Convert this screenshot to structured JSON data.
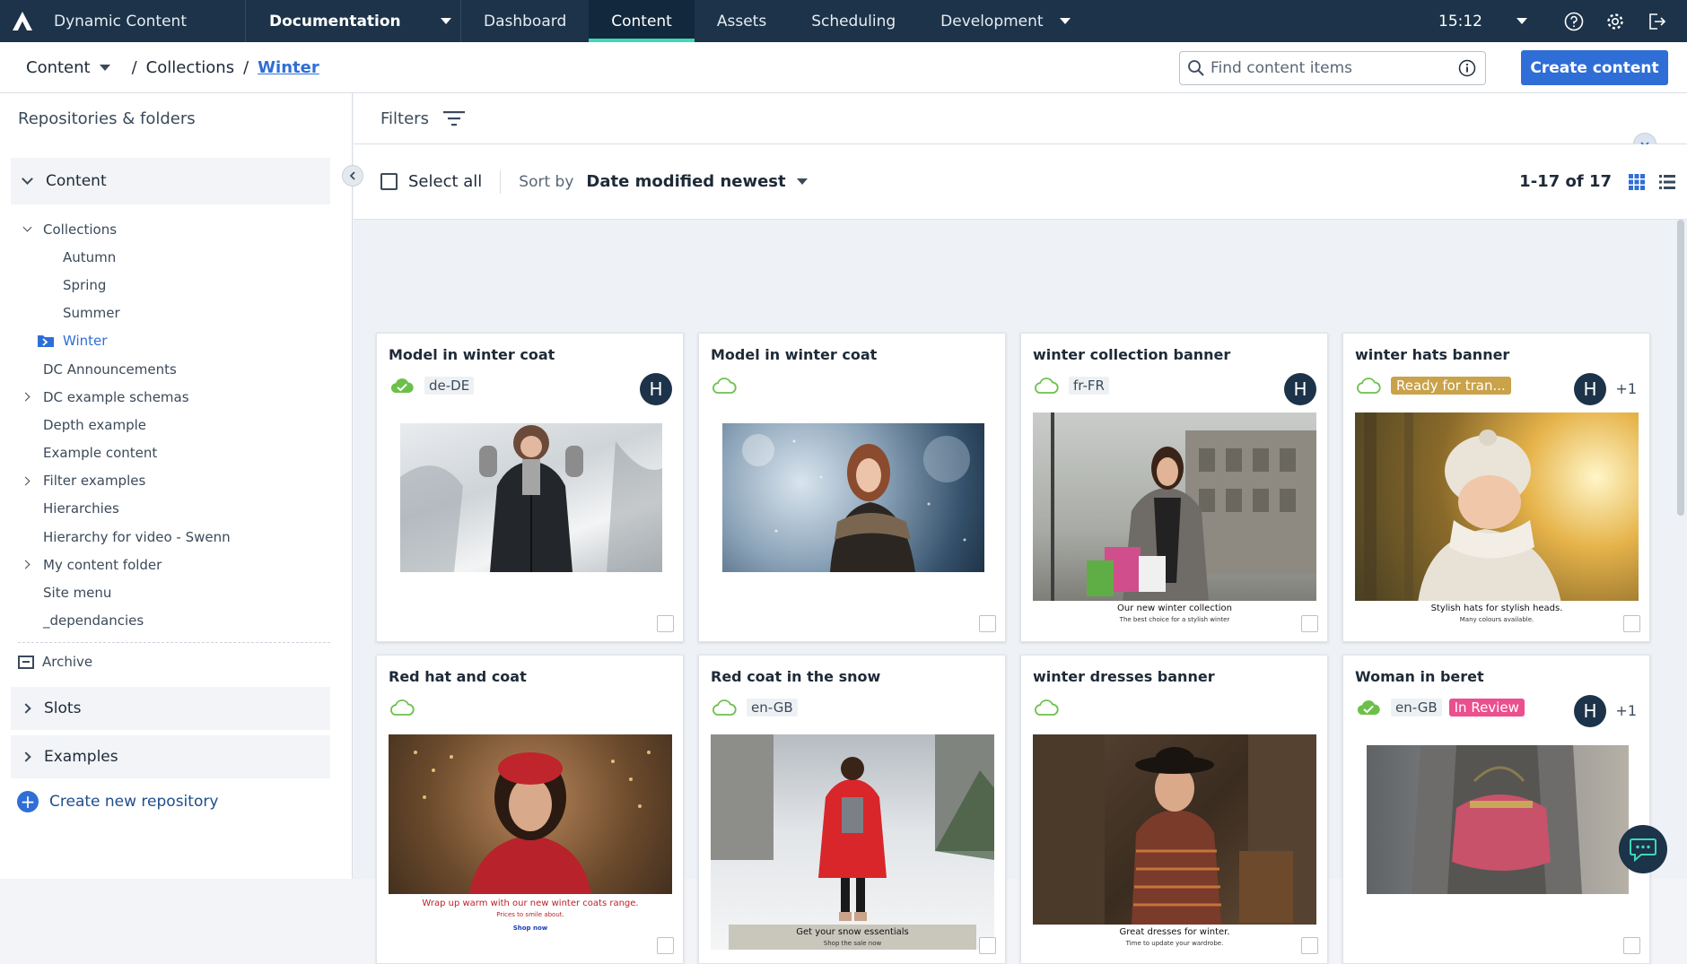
{
  "app": {
    "name": "Dynamic Content",
    "hub": "Documentation"
  },
  "nav": {
    "items": [
      "Dashboard",
      "Content",
      "Assets",
      "Scheduling",
      "Development"
    ],
    "active": "Content",
    "time": "15:12"
  },
  "breadcrumb": {
    "root": "Content",
    "parent": "Collections",
    "current": "Winter",
    "sep": "/"
  },
  "search": {
    "placeholder": "Find content items"
  },
  "create_button": "Create content",
  "sidebar": {
    "title": "Repositories & folders",
    "content_group": "Content",
    "tree": [
      {
        "label": "Collections"
      },
      {
        "label": "Autumn"
      },
      {
        "label": "Spring"
      },
      {
        "label": "Summer"
      },
      {
        "label": "Winter"
      },
      {
        "label": "DC Announcements"
      },
      {
        "label": "DC example schemas"
      },
      {
        "label": "Depth example"
      },
      {
        "label": "Example content"
      },
      {
        "label": "Filter examples"
      },
      {
        "label": "Hierarchies"
      },
      {
        "label": "Hierarchy for video - Swenn"
      },
      {
        "label": "My content folder"
      },
      {
        "label": "Site menu"
      },
      {
        "label": "_dependancies"
      }
    ],
    "archive": "Archive",
    "slots": "Slots",
    "examples": "Examples",
    "create_repo": "Create new repository"
  },
  "filters": {
    "label": "Filters"
  },
  "toolbar": {
    "select_all": "Select all",
    "sort_by": "Sort by",
    "sort_value": "Date modified newest",
    "count": "1-17 of 17"
  },
  "colors": {
    "accent": "#2f6ed6",
    "nav_bg": "#1c3349",
    "active_underline": "#3fd8b6",
    "published_green": "#6cc04a",
    "ready_status": "#c9a24a",
    "review_status": "#ec4f8d"
  },
  "cards": [
    {
      "title": "Model in winter coat",
      "published": true,
      "locale": "de-DE",
      "status": "",
      "avatar": "H",
      "extra": ""
    },
    {
      "title": "Model in winter coat",
      "published": false,
      "locale": "",
      "status": "",
      "avatar": "",
      "extra": ""
    },
    {
      "title": "winter collection banner",
      "published": false,
      "locale": "fr-FR",
      "status": "",
      "avatar": "H",
      "extra": "",
      "caption": "Our new winter collection",
      "subcaption": "The best choice for a stylish winter"
    },
    {
      "title": "winter hats banner",
      "published": false,
      "locale": "",
      "status": "Ready for tran...",
      "avatar": "H",
      "extra": "+1",
      "caption": "Stylish hats for stylish heads.",
      "subcaption": "Many colours available."
    },
    {
      "title": "Red hat and coat",
      "published": false,
      "locale": "",
      "status": "",
      "avatar": "",
      "extra": "",
      "caption": "Wrap up warm with our new winter coats range.",
      "subcaption": "Prices to smile about.",
      "link": "Shop now"
    },
    {
      "title": "Red coat in the snow",
      "published": false,
      "locale": "en-GB",
      "status": "",
      "avatar": "",
      "extra": "",
      "caption": "Get your snow essentials",
      "subcaption": "Shop the sale now"
    },
    {
      "title": "winter dresses banner",
      "published": false,
      "locale": "",
      "status": "",
      "avatar": "",
      "extra": "",
      "caption": "Great dresses for winter.",
      "subcaption": "Time to update your wardrobe."
    },
    {
      "title": "Woman in beret",
      "published": true,
      "locale": "en-GB",
      "status": "In Review",
      "avatar": "H",
      "extra": "+1"
    }
  ]
}
